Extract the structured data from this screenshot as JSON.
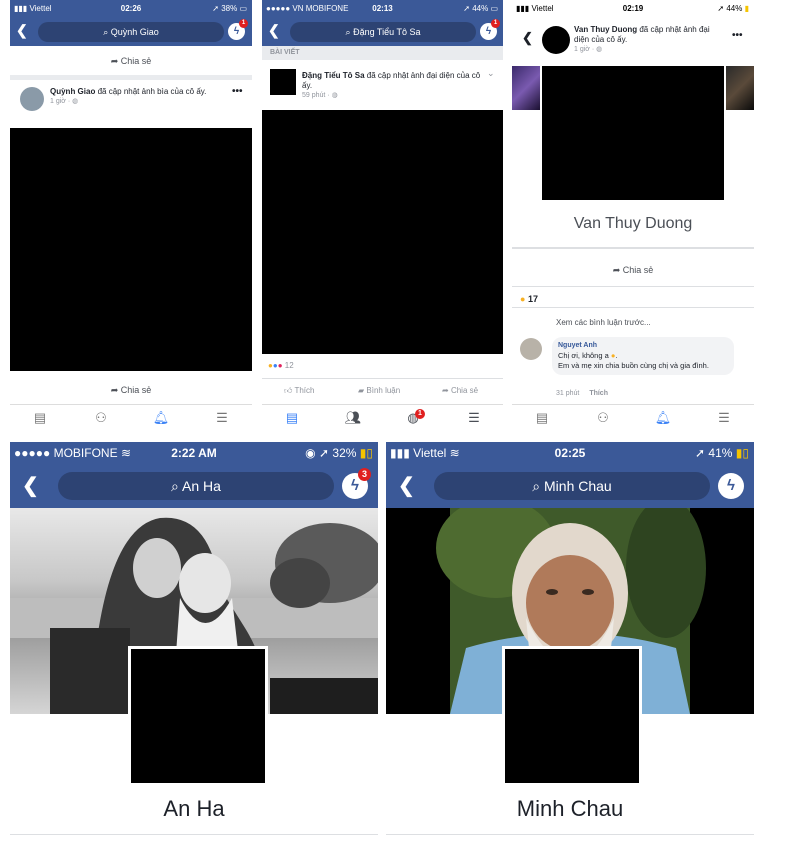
{
  "p1": {
    "status": {
      "carrier": "Viettel",
      "time": "02:26",
      "battery": "38%"
    },
    "search": "Quỳnh Giao",
    "badge": "1",
    "share_top": "Chia sẻ",
    "post": {
      "name": "Quỳnh Giao",
      "action": "đã cập nhật ảnh bìa của cô ấy.",
      "time": "1 giờ ·"
    },
    "share_bottom": "Chia sẻ"
  },
  "p2": {
    "status": {
      "carrier": "VN MOBIFONE",
      "time": "02:13",
      "battery": "44%"
    },
    "search": "Đặng Tiểu Tô Sa",
    "badge": "1",
    "section": "BÀI VIẾT",
    "post": {
      "name": "Đặng Tiểu Tô Sa",
      "action": "đã cập nhật ảnh đại diện của cô ấy.",
      "time": "59 phút ·"
    },
    "reactions_count": "12",
    "actions": {
      "like": "Thích",
      "comment": "Bình luận",
      "share": "Chia sẻ"
    },
    "tab_badge": "1"
  },
  "p3": {
    "status": {
      "carrier": "Viettel",
      "time": "02:19",
      "battery": "44%"
    },
    "post": {
      "name": "Van Thuy Duong",
      "action": "đã cập nhật ảnh đại diện của cô ấy.",
      "time": "1 giờ ·"
    },
    "profile_name": "Van Thuy Duong",
    "share": "Chia sẻ",
    "reactions_count": "17",
    "view_more": "Xem các bình luận trước...",
    "comment": {
      "author": "Nguyet Anh",
      "line1": "Chị ơi, không a",
      "line2": "Em và mẹ xin chia buồn cùng chị và gia đình.",
      "time": "31 phút",
      "like": "Thích"
    }
  },
  "p4": {
    "status": {
      "carrier": "MOBIFONE",
      "time": "2:22 AM",
      "battery": "32%"
    },
    "search": "An Ha",
    "badge": "3",
    "profile_name": "An Ha"
  },
  "p5": {
    "status": {
      "carrier": "Viettel",
      "time": "02:25",
      "battery": "41%"
    },
    "search": "Minh Chau",
    "profile_name": "Minh Chau"
  }
}
